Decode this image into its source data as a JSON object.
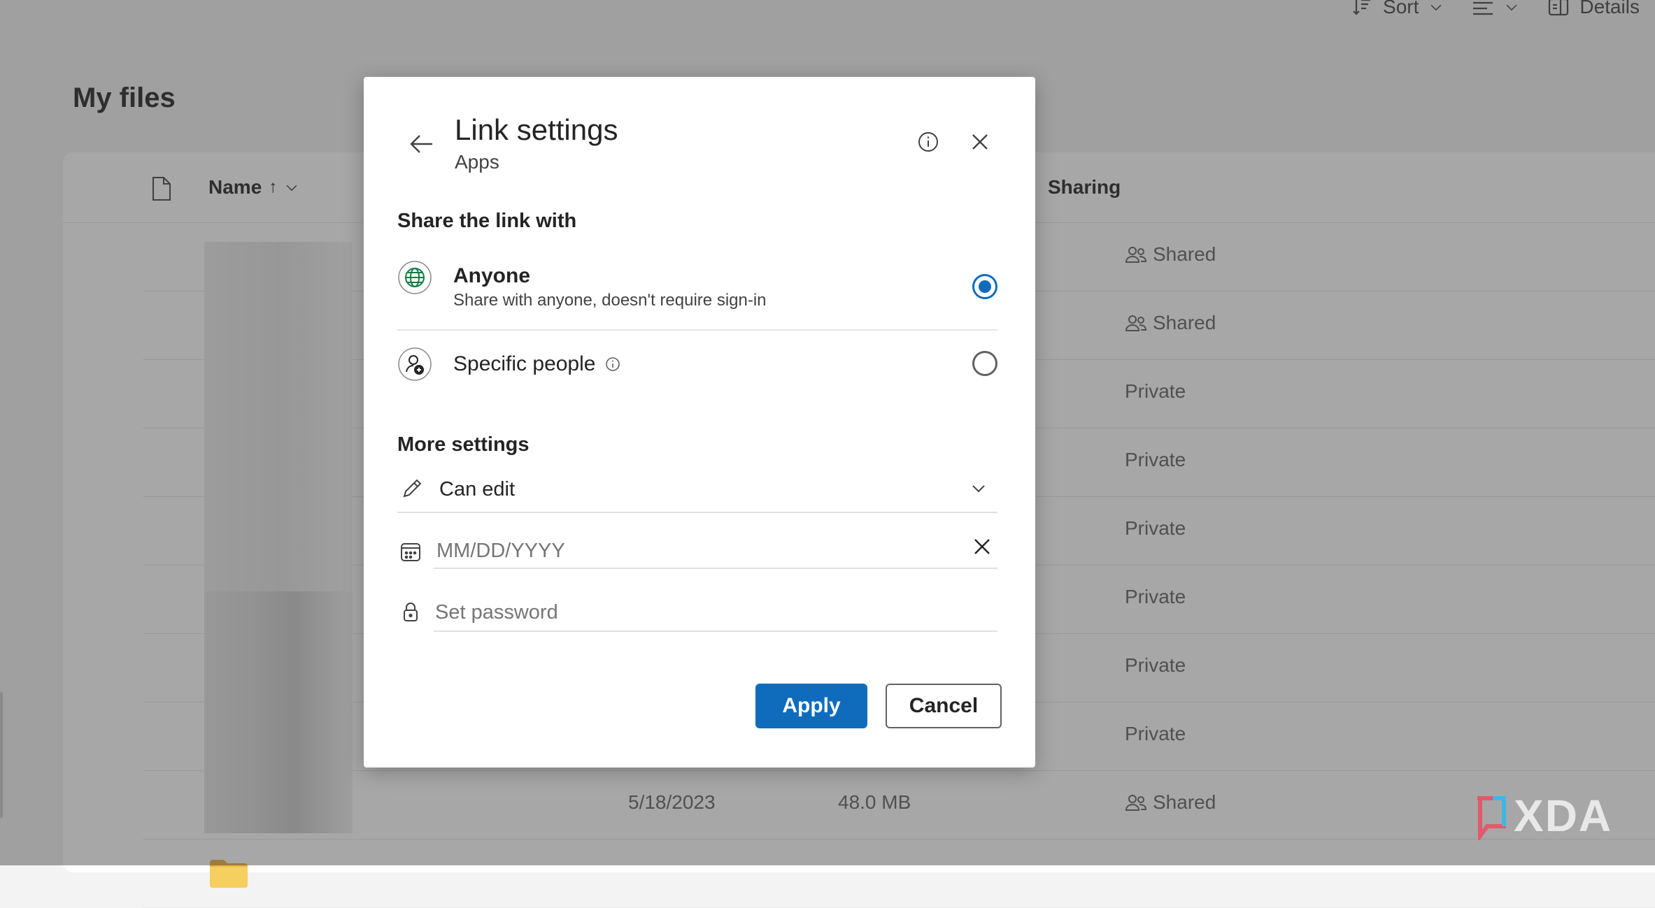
{
  "toolbar": {
    "sort_label": "Sort",
    "details_label": "Details"
  },
  "page_title": "My files",
  "list": {
    "columns": {
      "name": "Name",
      "sort_indicator": "↑",
      "sharing": "Sharing"
    },
    "rows": [
      {
        "type": "shared-folder",
        "sharing": "Shared",
        "modified": "",
        "size": ""
      },
      {
        "type": "shared-folder",
        "sharing": "Shared",
        "modified": "",
        "size": ""
      },
      {
        "type": "folder",
        "sharing": "Private",
        "modified": "",
        "size": ""
      },
      {
        "type": "folder",
        "sharing": "Private",
        "modified": "",
        "size": ""
      },
      {
        "type": "folder",
        "sharing": "Private",
        "modified": "",
        "size": ""
      },
      {
        "type": "folder",
        "sharing": "Private",
        "modified": "",
        "size": ""
      },
      {
        "type": "folder",
        "sharing": "Private",
        "modified": "",
        "size": ""
      },
      {
        "type": "folder",
        "sharing": "Private",
        "modified": "",
        "size": ""
      },
      {
        "type": "shared-folder",
        "sharing": "Shared",
        "modified": "5/18/2023",
        "size": "48.0 MB"
      }
    ]
  },
  "dialog": {
    "title": "Link settings",
    "subtitle": "Apps",
    "share_heading": "Share the link with",
    "options": [
      {
        "id": "anyone",
        "title": "Anyone",
        "description": "Share with anyone, doesn't require sign-in",
        "selected": true
      },
      {
        "id": "specific",
        "title": "Specific people",
        "description": "",
        "selected": false
      }
    ],
    "more_heading": "More settings",
    "permission": {
      "value": "Can edit"
    },
    "expiry": {
      "placeholder": "MM/DD/YYYY",
      "value": ""
    },
    "password": {
      "placeholder": "Set password",
      "value": ""
    },
    "apply_label": "Apply",
    "cancel_label": "Cancel"
  },
  "watermark": "XDA",
  "colors": {
    "accent": "#0f6cbd",
    "folder": "#f2c24f",
    "anyone_icon": "#107c41",
    "overlay": "rgba(60,60,60,0.45)"
  }
}
